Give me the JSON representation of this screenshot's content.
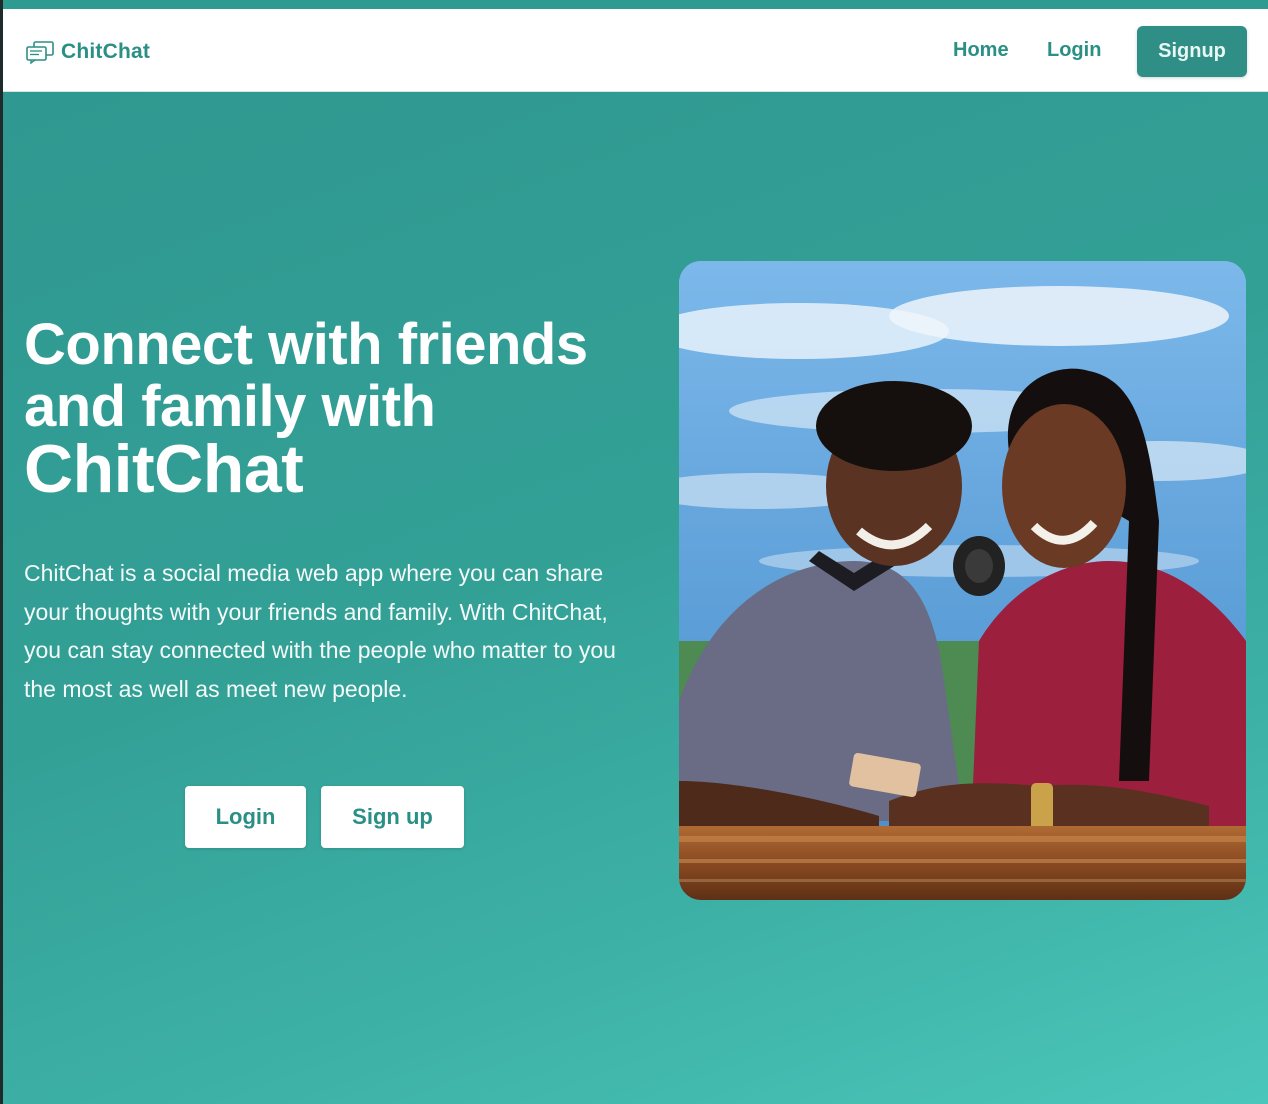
{
  "app": {
    "brand_name": "ChitChat",
    "colors": {
      "accent": "#2f8f86",
      "hero_top": "#2f9890",
      "hero_bottom": "#4bc6ba",
      "text_on_accent": "#ffffff"
    }
  },
  "nav": {
    "logo_icon": "chat-bubbles-icon",
    "home_label": "Home",
    "login_label": "Login",
    "signup_label": "Signup"
  },
  "hero": {
    "headline_part1": "Connect with friends and family with",
    "headline_brand": "ChitChat",
    "description": "ChitChat is a social media web app where you can share your thoughts with your friends and family. With ChitChat, you can stay connected with the people who matter to you the most as well as meet new people.",
    "login_button": "Login",
    "signup_button": "Sign up",
    "image_subject": "two smiling friends sharing headphones and looking at a phone"
  }
}
